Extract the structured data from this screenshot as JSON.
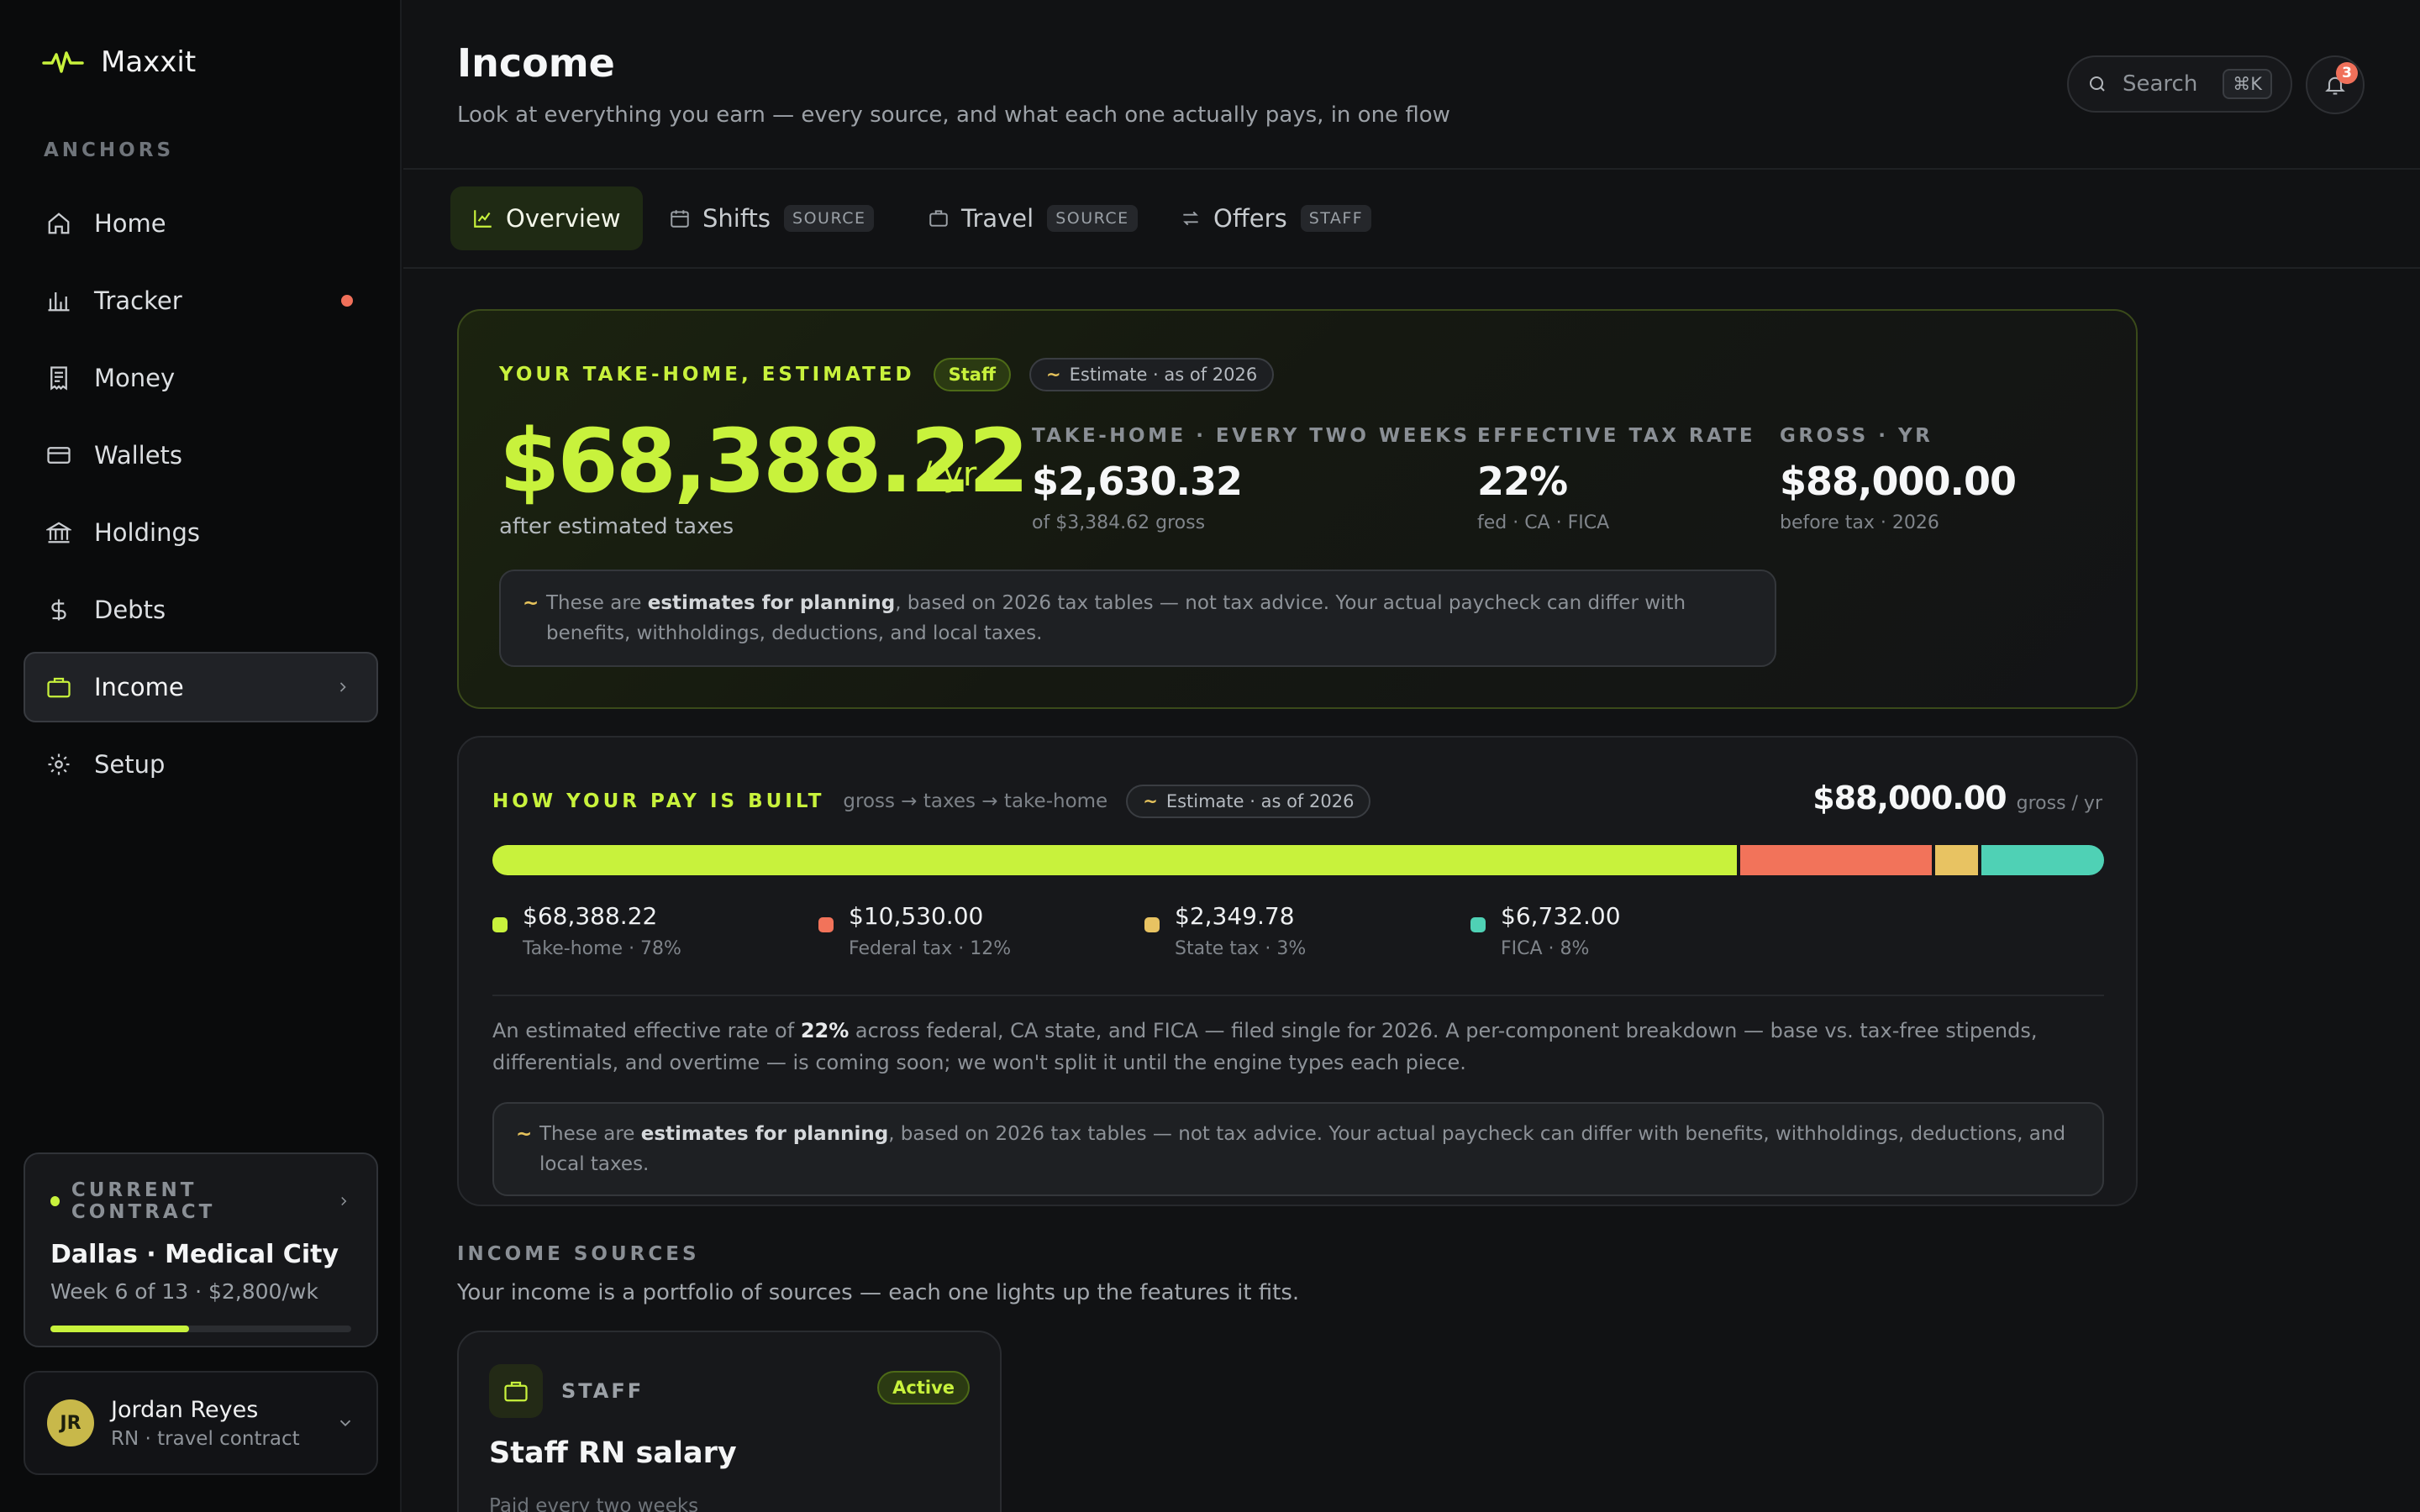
{
  "app": {
    "name": "Maxxit",
    "accent": "#c8f23c"
  },
  "sidebar": {
    "section_label": "ANCHORS",
    "items": [
      {
        "label": "Home",
        "icon": "home-icon"
      },
      {
        "label": "Tracker",
        "icon": "bar-chart-icon",
        "has_alert": true
      },
      {
        "label": "Money",
        "icon": "receipt-icon"
      },
      {
        "label": "Wallets",
        "icon": "credit-card-icon"
      },
      {
        "label": "Holdings",
        "icon": "bank-icon"
      },
      {
        "label": "Debts",
        "icon": "dollar-icon"
      },
      {
        "label": "Income",
        "icon": "briefcase-icon",
        "active": true
      },
      {
        "label": "Setup",
        "icon": "gear-icon"
      }
    ],
    "contract": {
      "label": "CURRENT CONTRACT",
      "title": "Dallas · Medical City",
      "subtitle": "Week 6 of 13 · $2,800/wk",
      "progress": 0.46
    },
    "user": {
      "initials": "JR",
      "name": "Jordan Reyes",
      "role": "RN · travel contract"
    }
  },
  "header": {
    "title": "Income",
    "subtitle": "Look at everything you earn — every source, and what each one actually pays, in one flow",
    "search_label": "Search",
    "search_shortcut": "⌘K",
    "notification_count": "3"
  },
  "tabs": [
    {
      "label": "Overview",
      "icon": "line-chart-icon",
      "active": true,
      "tag": ""
    },
    {
      "label": "Shifts",
      "icon": "calendar-icon",
      "tag": "SOURCE"
    },
    {
      "label": "Travel",
      "icon": "suitcase-icon",
      "tag": "SOURCE"
    },
    {
      "label": "Offers",
      "icon": "arrows-icon",
      "tag": "STAFF"
    }
  ],
  "takehome": {
    "eyebrow": "YOUR TAKE-HOME, ESTIMATED",
    "badge": "Staff",
    "estimate_pill": "Estimate · as of 2026",
    "estimate_mark": "~",
    "amount": "$68,388.22",
    "unit": "/ yr",
    "amount_sub": "after estimated taxes",
    "stats": [
      {
        "label": "TAKE-HOME · EVERY TWO WEEKS",
        "value": "$2,630.32",
        "sub": "of $3,384.62 gross"
      },
      {
        "label": "EFFECTIVE TAX RATE",
        "value": "22%",
        "sub": "fed · CA · FICA"
      },
      {
        "label": "GROSS · YR",
        "value": "$88,000.00",
        "sub": "before tax · 2026"
      }
    ],
    "note_pre": "These are ",
    "note_bold": "estimates for planning",
    "note_post": ", based on 2026 tax tables — not tax advice. Your actual paycheck can differ with benefits, withholdings, deductions, and local taxes."
  },
  "breakdown": {
    "eyebrow": "HOW YOUR PAY IS BUILT",
    "flow": "gross → taxes → take-home",
    "estimate_pill": "Estimate · as of 2026",
    "total": "$88,000.00",
    "total_unit": "gross / yr",
    "segments": [
      {
        "value": "$68,388.22",
        "label": "Take-home · 78%",
        "share": 0.7771,
        "color": "#c8f23c"
      },
      {
        "value": "$10,530.00",
        "label": "Federal tax · 12%",
        "share": 0.1197,
        "color": "#f2735a"
      },
      {
        "value": "$2,349.78",
        "label": "State tax · 3%",
        "share": 0.0267,
        "color": "#e8c362"
      },
      {
        "value": "$6,732.00",
        "label": "FICA · 8%",
        "share": 0.0765,
        "color": "#4fd1b5"
      }
    ],
    "para_pre": "An estimated effective rate of ",
    "para_bold": "22%",
    "para_post": " across federal, CA state, and FICA — filed single for 2026. A per-component breakdown — base vs. tax-free stipends, differentials, and overtime — is coming soon; we won't split it until the engine types each piece.",
    "note_pre": "These are ",
    "note_bold": "estimates for planning",
    "note_post": ", based on 2026 tax tables — not tax advice. Your actual paycheck can differ with benefits, withholdings, deductions, and local taxes."
  },
  "income_sources": {
    "label": "INCOME SOURCES",
    "subtitle": "Your income is a portfolio of sources — each one lights up the features it fits.",
    "cards": [
      {
        "type": "STAFF",
        "status": "Active",
        "name": "Staff RN salary",
        "frequency": "Paid every two weeks"
      }
    ]
  }
}
